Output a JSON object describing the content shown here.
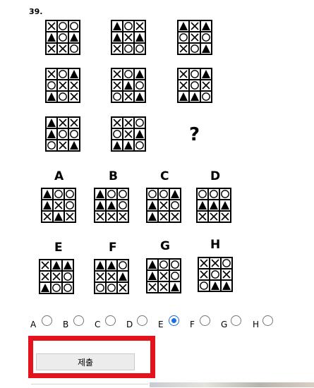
{
  "question": {
    "number": "39."
  },
  "puzzle_grids": [
    [
      "X",
      "O",
      "O",
      "T",
      "O",
      "T",
      "X",
      "X",
      "O"
    ],
    [
      "T",
      "O",
      "X",
      "T",
      "X",
      "T",
      "X",
      "O",
      "O"
    ],
    [
      "T",
      "X",
      "T",
      "O",
      "X",
      "O",
      "X",
      "O",
      "T"
    ],
    [
      "X",
      "O",
      "T",
      "O",
      "X",
      "X",
      "T",
      "O",
      "X"
    ],
    [
      "X",
      "O",
      "T",
      "X",
      "T",
      "O",
      "O",
      "X",
      "T"
    ],
    [
      "X",
      "O",
      "T",
      "X",
      "O",
      "X",
      "T",
      "T",
      "O"
    ],
    [
      "T",
      "X",
      "X",
      "T",
      "O",
      "O",
      "O",
      "X",
      "T"
    ],
    [
      "X",
      "X",
      "O",
      "O",
      "X",
      "T",
      "T",
      "T",
      "O"
    ]
  ],
  "question_mark": "?",
  "options": [
    {
      "label": "A",
      "cells": [
        "T",
        "O",
        "O",
        "T",
        "X",
        "O",
        "X",
        "T",
        "X"
      ]
    },
    {
      "label": "B",
      "cells": [
        "T",
        "O",
        "O",
        "T",
        "T",
        "O",
        "X",
        "X",
        "X"
      ]
    },
    {
      "label": "C",
      "cells": [
        "O",
        "O",
        "T",
        "T",
        "X",
        "O",
        "T",
        "X",
        "X"
      ]
    },
    {
      "label": "D",
      "cells": [
        "O",
        "O",
        "O",
        "T",
        "T",
        "T",
        "X",
        "X",
        "X"
      ]
    },
    {
      "label": "E",
      "cells": [
        "X",
        "T",
        "T",
        "X",
        "X",
        "O",
        "T",
        "O",
        "O"
      ]
    },
    {
      "label": "F",
      "cells": [
        "T",
        "T",
        "O",
        "X",
        "X",
        "T",
        "O",
        "O",
        "X"
      ]
    },
    {
      "label": "G",
      "cells": [
        "T",
        "O",
        "O",
        "T",
        "X",
        "O",
        "X",
        "X",
        "T"
      ]
    },
    {
      "label": "H",
      "cells": [
        "X",
        "X",
        "O",
        "X",
        "O",
        "X",
        "O",
        "T",
        "T"
      ]
    }
  ],
  "answer_radios": [
    {
      "label": "A",
      "checked": false
    },
    {
      "label": "B",
      "checked": false
    },
    {
      "label": "C",
      "checked": false
    },
    {
      "label": "D",
      "checked": false
    },
    {
      "label": "E",
      "checked": true
    },
    {
      "label": "F",
      "checked": false
    },
    {
      "label": "G",
      "checked": false
    },
    {
      "label": "H",
      "checked": false
    }
  ],
  "submit": {
    "label": "제출"
  },
  "colors": {
    "highlight": "#e4131b",
    "radio_checked": "#1e6fd9"
  },
  "icons": {
    "X": "x-mark-icon",
    "O": "circle-icon",
    "T": "triangle-icon"
  }
}
